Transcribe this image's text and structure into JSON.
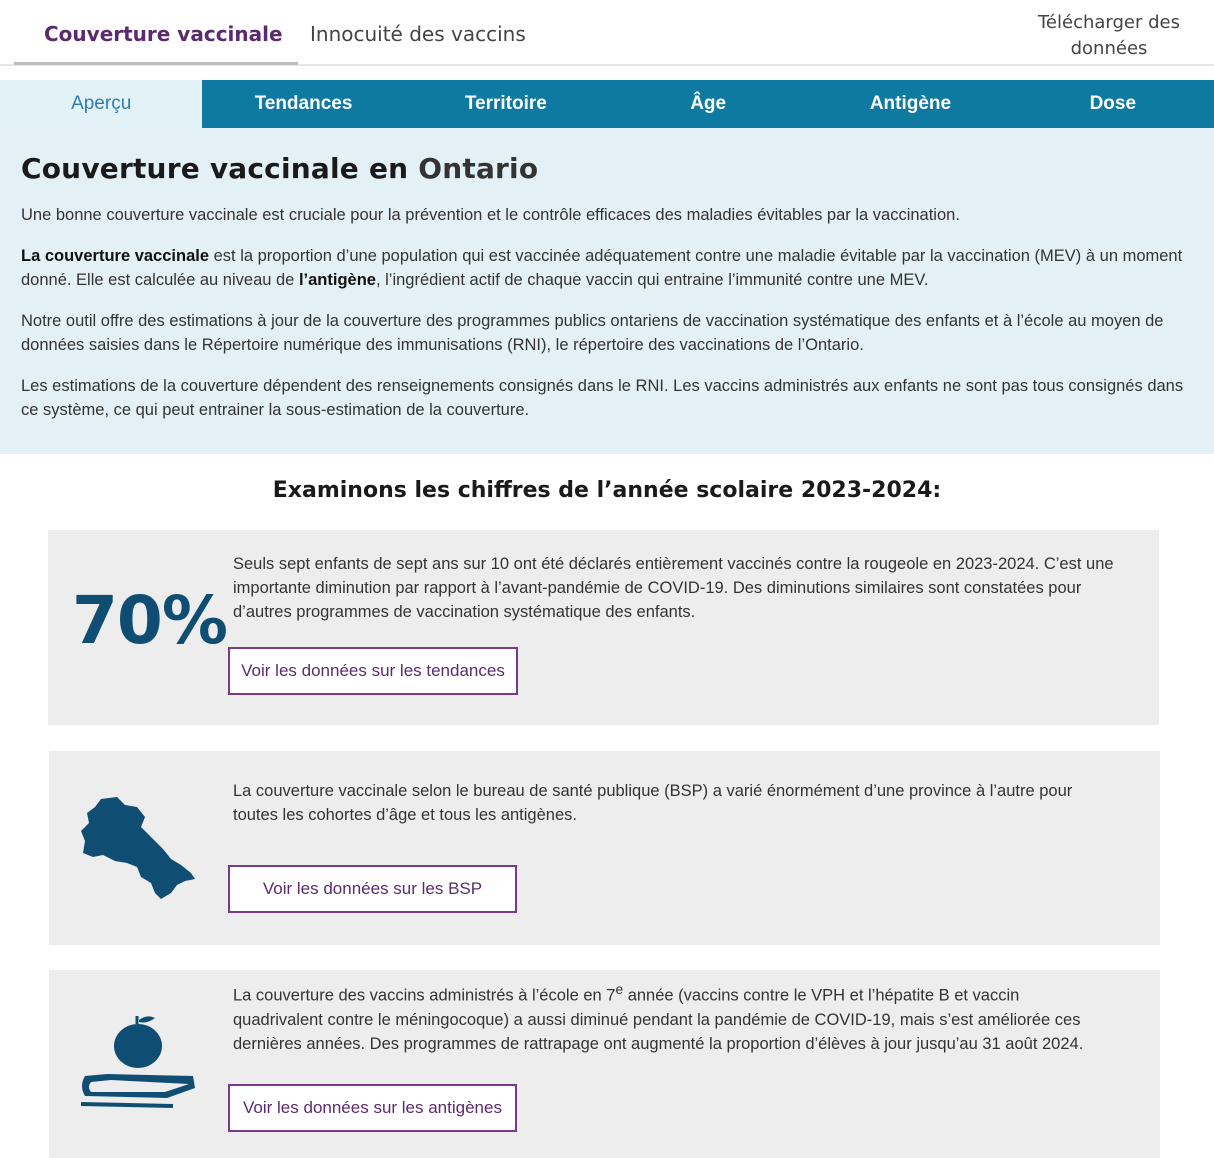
{
  "top_nav": {
    "tabs": [
      {
        "label": "Couverture vaccinale"
      },
      {
        "label": "Innocuité des vaccins"
      }
    ],
    "download_label_line1": "Télécharger des",
    "download_label_line2": "données"
  },
  "sub_nav": {
    "tabs": [
      {
        "label": "Aperçu"
      },
      {
        "label": "Tendances"
      },
      {
        "label": "Territoire"
      },
      {
        "label": "Âge"
      },
      {
        "label": "Antigène"
      },
      {
        "label": "Dose"
      }
    ],
    "active": "Aperçu"
  },
  "intro": {
    "title_prefix": "Couverture vaccinale en ",
    "title_location": "Ontario",
    "p1": "Une bonne couverture vaccinale est cruciale pour la prévention et le contrôle efficaces des maladies évitables par la vaccination.",
    "p2_bold": "La couverture vaccinale",
    "p2_a": " est la proportion d’une population qui est vaccinée adéquatement contre une maladie évitable par la vaccination (MEV) à un moment donné. Elle est calculée au niveau de ",
    "p2_bold2": "l’antigène",
    "p2_b": ", l’ingrédient actif de chaque vaccin qui entraine l’immunité contre une MEV.",
    "p3": "Notre outil offre des estimations à jour de la couverture des programmes publics ontariens de vaccination systématique des enfants et à l’école au moyen de données saisies dans le Répertoire numérique des immunisations (RNI), le répertoire des vaccinations de l’Ontario.",
    "p4": "Les estimations de la couverture dépendent des renseignements consignés dans le RNI. Les vaccins administrés aux enfants ne sont pas tous consignés dans ce système, ce qui peut entrainer la sous-estimation de la couverture."
  },
  "section_title": "Examinons les chiffres de l’année scolaire 2023-2024:",
  "cards": [
    {
      "big_number": "70%",
      "text": "Seuls sept enfants de sept ans sur 10 ont été déclarés entièrement vaccinés contre la rougeole en 2023-2024. C’est une importante diminution par rapport à l’avant-pandémie de COVID-19. Des diminutions similaires sont constatées pour d’autres programmes de vaccination systématique des enfants.",
      "button": "Voir les données sur les tendances"
    },
    {
      "icon": "ontario-map-icon",
      "text": "La couverture vaccinale selon le bureau de santé publique (BSP) a varié énormément d’une province à l’autre pour toutes les cohortes d’âge et tous les antigènes.",
      "button": "Voir les données sur les BSP"
    },
    {
      "icon": "book-apple-icon",
      "text_a": "La couverture des vaccins administrés à l’école en 7",
      "text_sup": "e",
      "text_b": " année (vaccins contre le VPH et l’hépatite B et vaccin quadrivalent contre le méningocoque) a aussi diminué pendant la pandémie de COVID-19, mais s’est améliorée ces dernières années. Des programmes de rattrapage ont augmenté la proportion d’élèves à jour jusqu’au 31 août 2024.",
      "button": "Voir les données sur les antigènes"
    }
  ],
  "colors": {
    "accent_purple": "#5b2a6e",
    "tab_blue": "#0f7aa1",
    "panel_bg": "#e3f1f6",
    "card_bg": "#ededed",
    "big_number": "#0f4d73"
  }
}
